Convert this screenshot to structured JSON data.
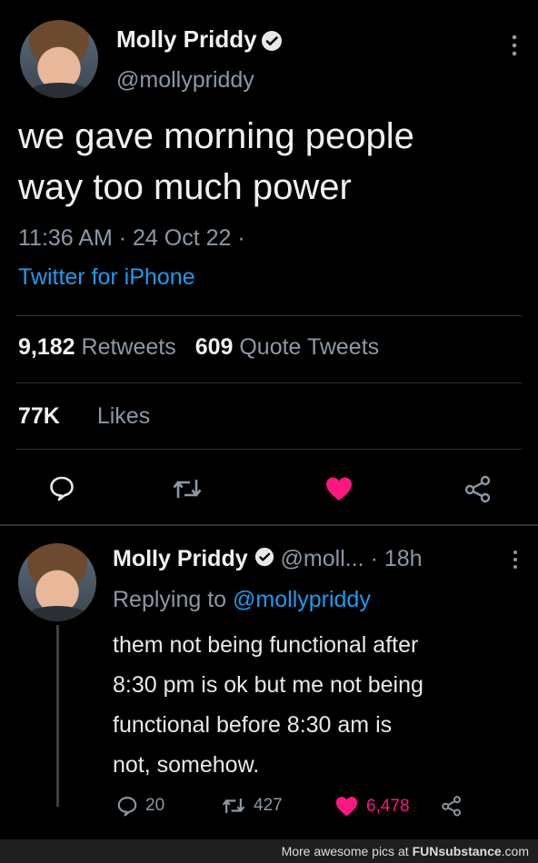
{
  "tweet": {
    "author_name": "Molly Priddy",
    "handle": "@mollypriddy",
    "text_line1": "we gave morning people",
    "text_line2": "way too much power",
    "timestamp": "11:36 AM · 24 Oct 22 ·",
    "source": "Twitter for iPhone",
    "retweets_count": "9,182",
    "retweets_label": "Retweets",
    "quotes_count": "609",
    "quotes_label": "Quote Tweets",
    "likes_count": "77K",
    "likes_label": "Likes"
  },
  "reply": {
    "author_name": "Molly Priddy",
    "handle": "@moll...",
    "age": "· 18h",
    "replying_to_prefix": "Replying to",
    "replying_to_handle": "@mollypriddy",
    "text_lines": [
      "them not being functional after",
      "8:30 pm is ok but me not being",
      "functional before 8:30 am is",
      "not, somehow."
    ],
    "reply_count": "20",
    "retweet_count": "427",
    "like_count": "6,478"
  },
  "footer": {
    "text": "More awesome pics at",
    "brand": "FUNsubstance",
    "domain": ".com"
  },
  "colors": {
    "background": "#000000",
    "link": "#1d9bf0",
    "like": "#f91880",
    "muted": "#8b98a5"
  },
  "icons": [
    "verified-badge-icon",
    "more-options-icon",
    "reply-icon",
    "retweet-icon",
    "heart-icon",
    "share-icon"
  ]
}
